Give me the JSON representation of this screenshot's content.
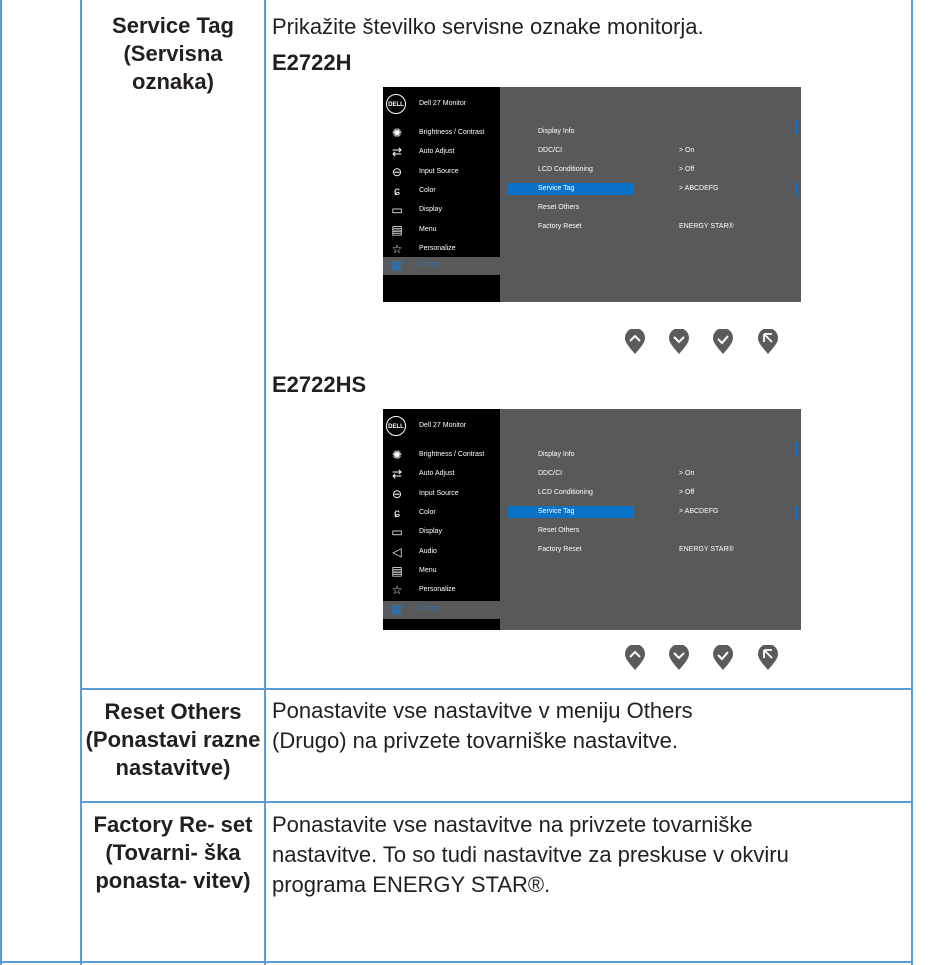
{
  "rows": {
    "service_tag": {
      "title": "Service Tag (Servisna oznaka)",
      "desc": "Prikažite številko servisne oznake monitorja.",
      "models": [
        "E2722H",
        "E2722HS"
      ]
    },
    "reset_others": {
      "title": "Reset Others (Ponastavi razne nastavitve)",
      "desc": "Ponastavite vse nastavitve v meniju Others (Drugo) na privzete tovarniške nastavitve."
    },
    "factory_reset": {
      "title": "Factory Re- set (Tovarni- ška ponasta- vitev)",
      "desc": "Ponastavite vse nastavitve na privzete tovarniške nastavitve. To so tudi nastavitve za preskuse v okviru programa ENERGY STAR®."
    }
  },
  "osd1": {
    "logo": "DELL",
    "title": "Dell 27 Monitor",
    "menu": [
      "Brightness / Contrast",
      "Auto Adjust",
      "Input Source",
      "Color",
      "Display",
      "Menu",
      "Personalize",
      "Others"
    ],
    "icons": [
      "brightness-icon",
      "auto-adjust-icon",
      "input-source-icon",
      "color-icon",
      "display-icon",
      "menu-icon",
      "personalize-icon",
      "others-icon"
    ],
    "options": [
      "Display Info",
      "DDC/CI",
      "LCD Conditioning",
      "Service Tag",
      "Reset Others",
      "Factory Reset"
    ],
    "values": [
      "> On",
      "> Off",
      "> ABCDEFG",
      "ENERGY STAR®"
    ]
  },
  "osd2": {
    "logo": "DELL",
    "title": "Dell 27 Monitor",
    "menu": [
      "Brightness / Contrast",
      "Auto Adjust",
      "Input Source",
      "Color",
      "Display",
      "Audio",
      "Menu",
      "Personalize",
      "Others"
    ],
    "icons": [
      "brightness-icon",
      "auto-adjust-icon",
      "input-source-icon",
      "color-icon",
      "display-icon",
      "audio-icon",
      "menu-icon",
      "personalize-icon",
      "others-icon"
    ],
    "options": [
      "Display Info",
      "DDC/CI",
      "LCD Conditioning",
      "Service Tag",
      "Reset Others",
      "Factory Reset"
    ],
    "values": [
      "> On",
      "> Off",
      "> ABCDEFG",
      "ENERGY STAR®"
    ]
  },
  "buttons": [
    "up-button-icon",
    "down-button-icon",
    "ok-button-icon",
    "back-button-icon"
  ],
  "colors": {
    "border": "#5b9bd5",
    "osd_bg": "#58595b",
    "osd_side": "#000000",
    "highlight": "#0b72c9"
  }
}
